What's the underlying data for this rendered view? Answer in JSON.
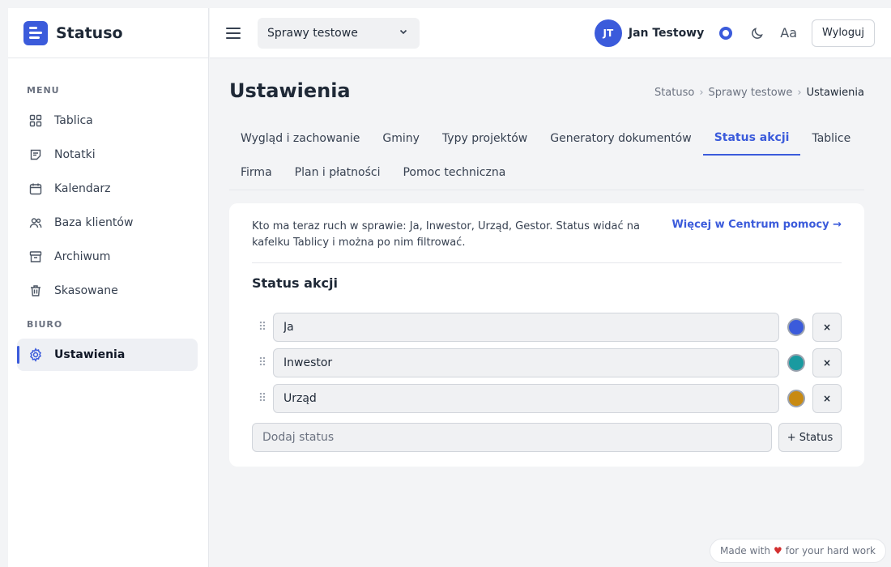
{
  "app": {
    "name": "Statuso"
  },
  "sidebar": {
    "menu_label": "MENU",
    "items": [
      {
        "label": "Tablica",
        "icon": "grid-icon"
      },
      {
        "label": "Notatki",
        "icon": "note-icon"
      },
      {
        "label": "Kalendarz",
        "icon": "calendar-icon"
      },
      {
        "label": "Baza klientów",
        "icon": "users-icon"
      },
      {
        "label": "Archiwum",
        "icon": "archive-icon"
      },
      {
        "label": "Skasowane",
        "icon": "trash-icon"
      }
    ],
    "biuro_label": "BIURO",
    "settings_item": {
      "label": "Ustawienia",
      "icon": "gear-icon"
    }
  },
  "topbar": {
    "case_select": "Sprawy testowe",
    "avatar_initials": "JT",
    "user_name": "Jan Testowy",
    "font_toggle": "Aa",
    "logout_label": "Wyloguj"
  },
  "page": {
    "title": "Ustawienia",
    "breadcrumb": [
      "Statuso",
      "Sprawy testowe",
      "Ustawienia"
    ]
  },
  "tabs": [
    {
      "label": "Wygląd i zachowanie",
      "active": false
    },
    {
      "label": "Gminy",
      "active": false
    },
    {
      "label": "Typy projektów",
      "active": false
    },
    {
      "label": "Generatory dokumentów",
      "active": false
    },
    {
      "label": "Status akcji",
      "active": true
    },
    {
      "label": "Tablice",
      "active": false
    },
    {
      "label": "Firma",
      "active": false
    },
    {
      "label": "Plan i płatności",
      "active": false
    },
    {
      "label": "Pomoc techniczna",
      "active": false
    }
  ],
  "card": {
    "description": "Kto ma teraz ruch w sprawie: Ja, Inwestor, Urząd, Gestor. Status widać na kafelku Tablicy i można po nim filtrować.",
    "help_link": "Więcej w Centrum pomocy →",
    "section_title": "Status akcji",
    "statuses": [
      {
        "value": "Ja",
        "color": "#3b5bdb"
      },
      {
        "value": "Inwestor",
        "color": "#1a9aa0"
      },
      {
        "value": "Urząd",
        "color": "#c88a12"
      }
    ],
    "delete_label": "×",
    "drag_glyph": "⠿",
    "add_placeholder": "Dodaj status",
    "add_button": "+ Status"
  },
  "footer": {
    "made_with": "Made with",
    "heart": "♥",
    "for_work": "for your hard work"
  },
  "colors": {
    "accent": "#3b5bdb",
    "heart": "#d32f2f"
  }
}
